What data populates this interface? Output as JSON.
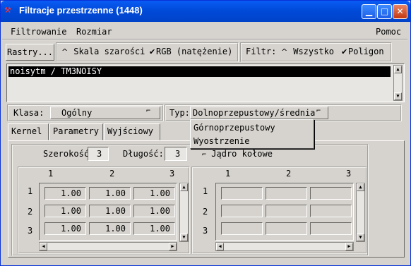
{
  "window": {
    "title": "Filtracje przestrzenne (1448)",
    "icon": "app-icon",
    "controls": [
      "minimize",
      "maximize",
      "close"
    ]
  },
  "menubar": {
    "filtrowanie": "Filtrowanie",
    "rozmiar": "Rozmiar",
    "pomoc": "Pomoc"
  },
  "toolbar": {
    "rastry": "Rastry...",
    "skala": "Skala szarości",
    "rgb": "RGB (natężenie)",
    "filtr_label": "Filtr:",
    "wszystko": "Wszystko",
    "poligon": "Poligon"
  },
  "listbox": {
    "items": [
      "noisytm / TM3NOISY"
    ],
    "selected_index": 0
  },
  "klasa": {
    "label": "Klasa:",
    "value": "Ogólny"
  },
  "typ": {
    "label": "Typ:",
    "value": "Dolnoprzepustowy/średnia",
    "options": [
      "Górnoprzepustowy",
      "Wyostrzenie"
    ]
  },
  "tabs": [
    "Kernel",
    "Parametry",
    "Wyjściowy"
  ],
  "kernel": {
    "szerokosc_label": "Szerokość",
    "szerokosc_value": "3",
    "dlugosc_label": "Długość:",
    "dlugosc_value": "3",
    "jadro_label": "Jądro kołowe",
    "col_headers": [
      "1",
      "2",
      "3"
    ],
    "row_headers": [
      "1",
      "2",
      "3"
    ],
    "left_grid": [
      [
        "1.00",
        "1.00",
        "1.00"
      ],
      [
        "1.00",
        "1.00",
        "1.00"
      ],
      [
        "1.00",
        "1.00",
        "1.00"
      ]
    ],
    "right_grid": [
      [
        "",
        "",
        ""
      ],
      [
        "",
        "",
        ""
      ],
      [
        "",
        "",
        ""
      ]
    ]
  }
}
